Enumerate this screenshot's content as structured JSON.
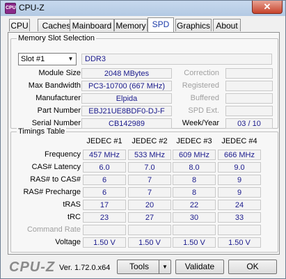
{
  "window": {
    "title": "CPU-Z",
    "icon_text": "CPU",
    "close_glyph": "✕"
  },
  "tabs": [
    {
      "label": "CPU"
    },
    {
      "label": "Caches"
    },
    {
      "label": "Mainboard"
    },
    {
      "label": "Memory"
    },
    {
      "label": "SPD",
      "active": true
    },
    {
      "label": "Graphics"
    },
    {
      "label": "About"
    }
  ],
  "memory_slot": {
    "group_label": "Memory Slot Selection",
    "slot_value": "Slot #1",
    "type": "DDR3",
    "labels": {
      "module_size": "Module Size",
      "max_bandwidth": "Max Bandwidth",
      "manufacturer": "Manufacturer",
      "part_number": "Part Number",
      "serial_number": "Serial Number",
      "correction": "Correction",
      "registered": "Registered",
      "buffered": "Buffered",
      "spd_ext": "SPD Ext.",
      "week_year": "Week/Year"
    },
    "values": {
      "module_size": "2048 MBytes",
      "max_bandwidth": "PC3-10700 (667 MHz)",
      "manufacturer": "Elpida",
      "part_number": "EBJ21UE8BDF0-DJ-F",
      "serial_number": "CB142989",
      "week_year": "03 / 10"
    }
  },
  "timings": {
    "group_label": "Timings Table",
    "columns": [
      "JEDEC #1",
      "JEDEC #2",
      "JEDEC #3",
      "JEDEC #4"
    ],
    "rows": [
      {
        "label": "Frequency",
        "values": [
          "457 MHz",
          "533 MHz",
          "609 MHz",
          "666 MHz"
        ]
      },
      {
        "label": "CAS# Latency",
        "values": [
          "6.0",
          "7.0",
          "8.0",
          "9.0"
        ]
      },
      {
        "label": "RAS# to CAS#",
        "values": [
          "6",
          "7",
          "8",
          "9"
        ]
      },
      {
        "label": "RAS# Precharge",
        "values": [
          "6",
          "7",
          "8",
          "9"
        ]
      },
      {
        "label": "tRAS",
        "values": [
          "17",
          "20",
          "22",
          "24"
        ]
      },
      {
        "label": "tRC",
        "values": [
          "23",
          "27",
          "30",
          "33"
        ]
      },
      {
        "label": "Command Rate",
        "values": [
          "",
          "",
          "",
          ""
        ],
        "disabled": true
      },
      {
        "label": "Voltage",
        "values": [
          "1.50 V",
          "1.50 V",
          "1.50 V",
          "1.50 V"
        ]
      }
    ]
  },
  "footer": {
    "logo": "CPU-Z",
    "version": "Ver. 1.72.0.x64",
    "tools_label": "Tools",
    "validate_label": "Validate",
    "ok_label": "OK"
  }
}
